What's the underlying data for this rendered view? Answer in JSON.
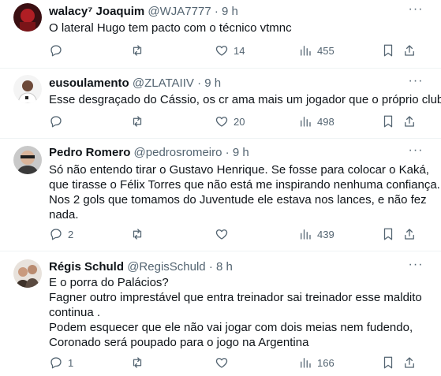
{
  "tweets": [
    {
      "author": {
        "name": "walacy⁷ Joaquim",
        "handle": "@WJA7777",
        "separator": "·",
        "time": "9 h"
      },
      "lines": [
        "O lateral Hugo tem pacto com o técnico vtmnc"
      ],
      "stats": {
        "replies": "",
        "retweets": "",
        "likes": "14",
        "views": "455"
      },
      "avatar_colors": [
        "#3b0f12",
        "#b01e24"
      ]
    },
    {
      "author": {
        "name": "eusoulamento",
        "handle": "@ZLATAIIV",
        "separator": "·",
        "time": "9 h"
      },
      "lines": [
        "Esse desgraçado do Cássio, os cr ama mais um jogador que o próprio clube"
      ],
      "stats": {
        "replies": "",
        "retweets": "",
        "likes": "20",
        "views": "498"
      },
      "avatar_colors": [
        "#f4f4f4",
        "#6d4a3a"
      ]
    },
    {
      "author": {
        "name": "Pedro Romero",
        "handle": "@pedrosromeiro",
        "separator": "·",
        "time": "9 h"
      },
      "lines": [
        "Só não entendo tirar o Gustavo Henrique. Se fosse para colocar o Kaká,",
        "que tirasse o Félix Torres que não está me inspirando nenhuma confiança.",
        "Nos 2 gols que tomamos do Juventude ele estava nos lances, e não fez",
        "nada."
      ],
      "stats": {
        "replies": "2",
        "retweets": "",
        "likes": "",
        "views": "439"
      },
      "avatar_colors": [
        "#c9c9c9",
        "#3a3a3a"
      ]
    },
    {
      "author": {
        "name": "Régis Schuld",
        "handle": "@RegisSchuld",
        "separator": "·",
        "time": "8 h"
      },
      "lines": [
        "E o porra do Palácios?",
        "Fagner outro imprestável que entra treinador sai treinador esse maldito",
        "continua .",
        "Podem esquecer que ele não vai jogar com dois meias nem fudendo,",
        "Coronado será poupado para o jogo na Argentina"
      ],
      "stats": {
        "replies": "1",
        "retweets": "",
        "likes": "",
        "views": "166"
      },
      "avatar_colors": [
        "#e8e2dc",
        "#3d3129"
      ]
    }
  ],
  "icons": {
    "reply": "reply-icon",
    "retweet": "retweet-icon",
    "like": "heart-icon",
    "views": "views-icon",
    "bookmark": "bookmark-icon",
    "share": "share-icon",
    "more": "more-icon"
  },
  "colors": {
    "text": "#0f1419",
    "secondary": "#536471",
    "divider": "#eff3f4"
  },
  "more_glyph": "···"
}
